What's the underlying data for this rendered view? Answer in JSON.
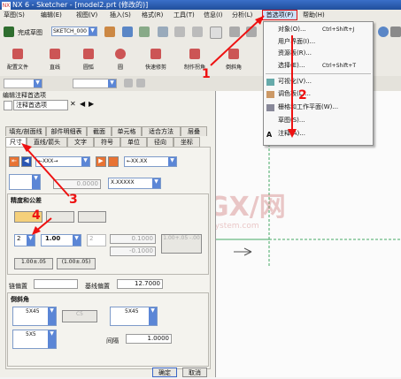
{
  "window": {
    "title": "NX 6 - Sketcher - [model2.prt (修改的)]"
  },
  "menubar": [
    "草图(S)",
    "编辑(E)",
    "视图(V)",
    "插入(S)",
    "格式(R)",
    "工具(T)",
    "信息(I)",
    "分析(L)",
    "首选项(P)",
    "帮助(H)"
  ],
  "toolbar": {
    "finish_sketch": "完成草图",
    "sketch_name": "SKETCH_000",
    "labels": [
      "配置文件",
      "直线",
      "圆弧",
      "圆",
      "快速修剪",
      "制作拐角",
      "倒斜角"
    ]
  },
  "dialog": {
    "title": "编辑注释首选项",
    "panel_tab": "注释首选项",
    "tabs_row1": [
      "填充/剖面线",
      "部件明细表",
      "截面",
      "单元格",
      "适合方法",
      "层叠"
    ],
    "tabs_row2": [
      "尺寸",
      "直线/箭头",
      "文字",
      "符号",
      "单位",
      "径向",
      "坐标"
    ],
    "row_text": {
      "text_ref": "←XXX→",
      "text_ref2": "←XX.XX",
      "dim_value": "0.0000",
      "format": "X.XXXXX"
    },
    "precision_tolerance": {
      "title": "精度和公差",
      "precision": "2",
      "tol_value": "1.00",
      "tol2": "2",
      "upper": "0.1000",
      "lower": "-0.1000",
      "limit_fmt": "1.00+.05 -.00",
      "btn_a": "1.00±.05",
      "btn_b": "(1.00±.05)"
    },
    "chain_offset_label": "链偏置",
    "baseline_offset_label": "基线偏置",
    "baseline_offset_value": "12.7000",
    "chamfer": {
      "title": "倒斜角",
      "fmt1": "5X45",
      "fmt_dim": "C5",
      "fmt2": "5X45",
      "fmt3": "5X5",
      "gap_label": "间隔",
      "gap_value": "1.0000"
    },
    "ok": "确定",
    "cancel": "取消"
  },
  "dropdown_menu": {
    "items": [
      {
        "label": "对象(O)...",
        "shortcut": "Ctrl+Shift+J"
      },
      {
        "label": "用户界面(I)...",
        "shortcut": ""
      },
      {
        "label": "资源板(R)...",
        "shortcut": ""
      },
      {
        "label": "选择(E)...",
        "shortcut": "Ctrl+Shift+T"
      },
      {
        "label": "可视化(V)...",
        "shortcut": ""
      },
      {
        "label": "调色板(L)...",
        "shortcut": ""
      },
      {
        "label": "栅格和工作平面(W)...",
        "shortcut": ""
      },
      {
        "label": "草图(S)...",
        "shortcut": ""
      },
      {
        "label": "注释(A)...",
        "shortcut": ""
      }
    ]
  },
  "annotations": {
    "step1": "1",
    "step2": "2",
    "step3": "3",
    "step4": "4"
  },
  "watermark": {
    "brand": "GX/网",
    "site": "system.com"
  },
  "colors": {
    "accent": "#e11",
    "menu_highlight": "#cfe0fb",
    "dropdown_blue": "#5b86d6"
  }
}
